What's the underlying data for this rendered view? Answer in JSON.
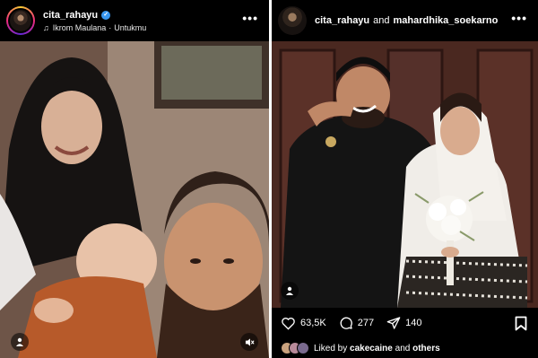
{
  "left_post": {
    "username": "cita_rahayu",
    "verified": true,
    "music_artist": "Ikrom Maulana",
    "music_separator": "·",
    "music_title": "Untukmu",
    "more_icon": "more-horizontal-icon",
    "user_tag_icon": "person-icon",
    "mute_icon": "muted-speaker-icon"
  },
  "right_post": {
    "username": "cita_rahayu",
    "conjunction": "and",
    "collaborator": "mahardhika_soekarno",
    "more_icon": "more-horizontal-icon",
    "user_tag_icon": "person-icon",
    "likes": "63,5K",
    "comments": "277",
    "shares": "140",
    "liked_by_prefix": "Liked by",
    "liked_by_user": "cakecaine",
    "liked_by_and": "and",
    "liked_by_suffix": "others"
  },
  "colors": {
    "background": "#000000",
    "verified": "#3897f0",
    "text": "#ffffff"
  }
}
